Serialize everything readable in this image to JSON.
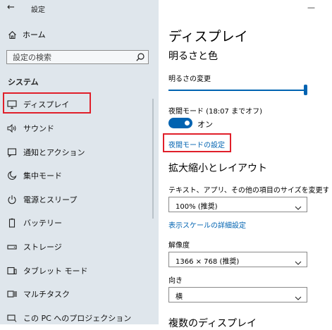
{
  "window": {
    "title": "設定",
    "back_icon": "back-arrow-icon"
  },
  "sidebar": {
    "home_label": "ホーム",
    "search": {
      "placeholder": "設定の検索",
      "value": ""
    },
    "section_title": "システム",
    "items": [
      {
        "label": "ディスプレイ",
        "icon": "monitor-icon",
        "selected": true
      },
      {
        "label": "サウンド",
        "icon": "speaker-icon"
      },
      {
        "label": "通知とアクション",
        "icon": "notification-icon"
      },
      {
        "label": "集中モード",
        "icon": "moon-icon"
      },
      {
        "label": "電源とスリープ",
        "icon": "power-icon"
      },
      {
        "label": "バッテリー",
        "icon": "battery-icon"
      },
      {
        "label": "ストレージ",
        "icon": "storage-icon"
      },
      {
        "label": "タブレット モード",
        "icon": "tablet-icon"
      },
      {
        "label": "マルチタスク",
        "icon": "multitask-icon"
      },
      {
        "label": "この PC へのプロジェクション",
        "icon": "projection-icon"
      }
    ]
  },
  "main": {
    "title": "ディスプレイ",
    "brightness_color_heading": "明るさと色",
    "brightness_label": "明るさの変更",
    "brightness_value": 1.0,
    "night_light_label": "夜間モード (18:07 までオフ)",
    "night_light_toggle": "オン",
    "night_light_on": true,
    "night_light_settings_link": "夜間モードの設定",
    "scale_layout_heading": "拡大縮小とレイアウト",
    "scale_label": "テキスト、アプリ、その他の項目のサイズを変更する",
    "scale_value": "100% (推奨)",
    "advanced_scaling_link": "表示スケールの詳細設定",
    "resolution_label": "解像度",
    "resolution_value": "1366 × 768 (推奨)",
    "orientation_label": "向き",
    "orientation_value": "横",
    "multiple_displays_heading": "複数のディスプレイ"
  },
  "colors": {
    "accent": "#0063b1",
    "highlight_border": "#e01f2a",
    "sidebar_bg": "#dfe6ec"
  }
}
